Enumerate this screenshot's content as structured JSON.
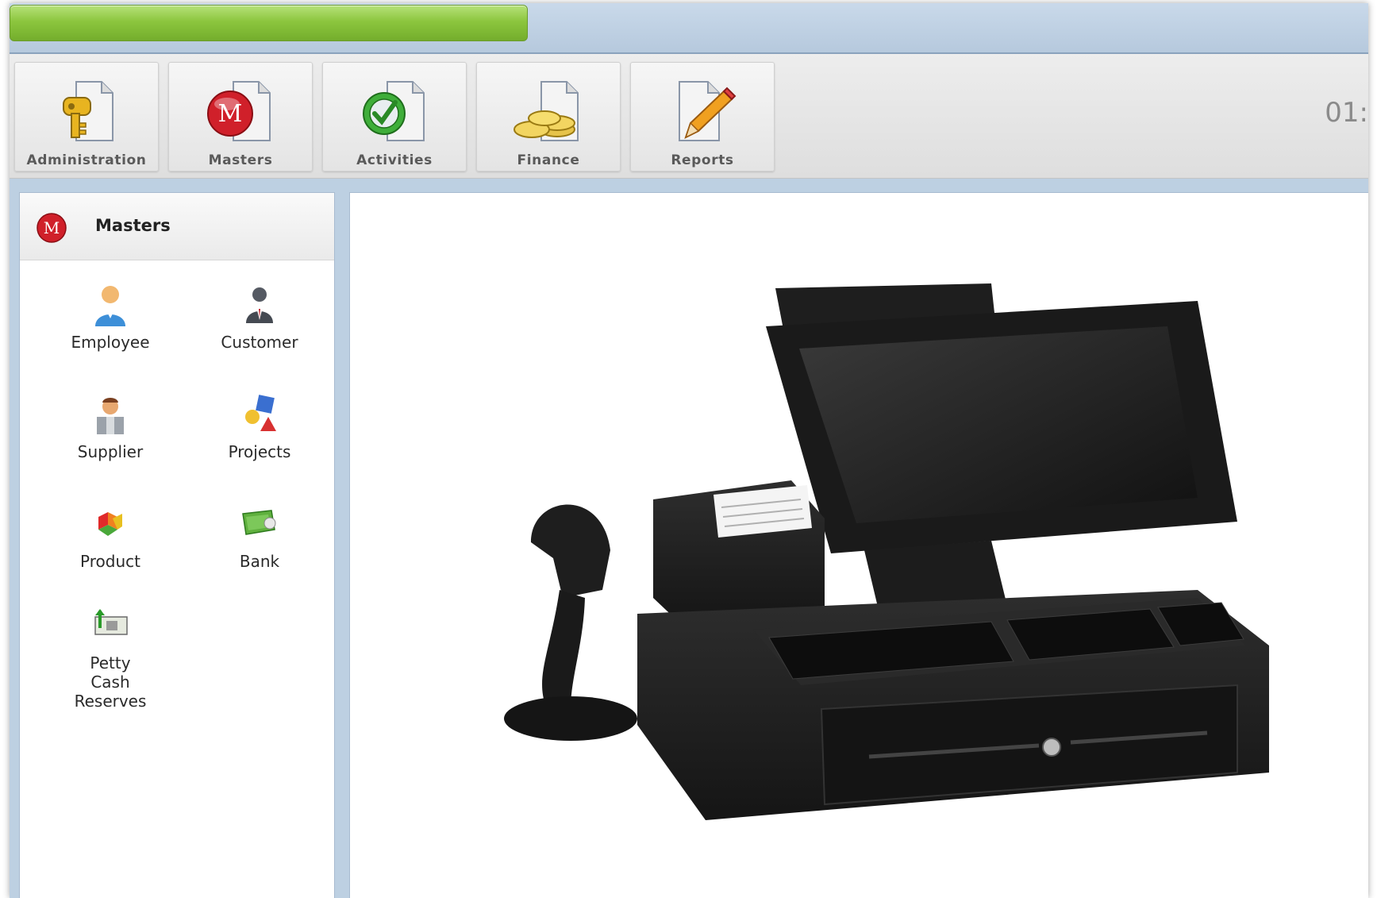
{
  "progress": {
    "fraction": 0.38
  },
  "toolbar": {
    "buttons": [
      {
        "label": "Administration",
        "icon": "key-document-icon"
      },
      {
        "label": "Masters",
        "icon": "masters-m-icon"
      },
      {
        "label": "Activities",
        "icon": "checkmark-document-icon"
      },
      {
        "label": "Finance",
        "icon": "coins-document-icon"
      },
      {
        "label": "Reports",
        "icon": "pencil-document-icon"
      }
    ],
    "clock": "01:"
  },
  "sidebar": {
    "title": "Masters",
    "items": [
      {
        "label": "Employee",
        "icon": "employee-icon"
      },
      {
        "label": "Customer",
        "icon": "customer-icon"
      },
      {
        "label": "Supplier",
        "icon": "supplier-icon"
      },
      {
        "label": "Projects",
        "icon": "projects-icon"
      },
      {
        "label": "Product",
        "icon": "product-icon"
      },
      {
        "label": "Bank",
        "icon": "bank-icon"
      },
      {
        "label": "Petty Cash Reserves",
        "icon": "petty-cash-icon"
      }
    ]
  },
  "main": {
    "image": "pos-terminal-image"
  },
  "colors": {
    "accent_green": "#8cc63e",
    "frame_blue": "#bdd0e2",
    "masters_red": "#d0202a"
  }
}
